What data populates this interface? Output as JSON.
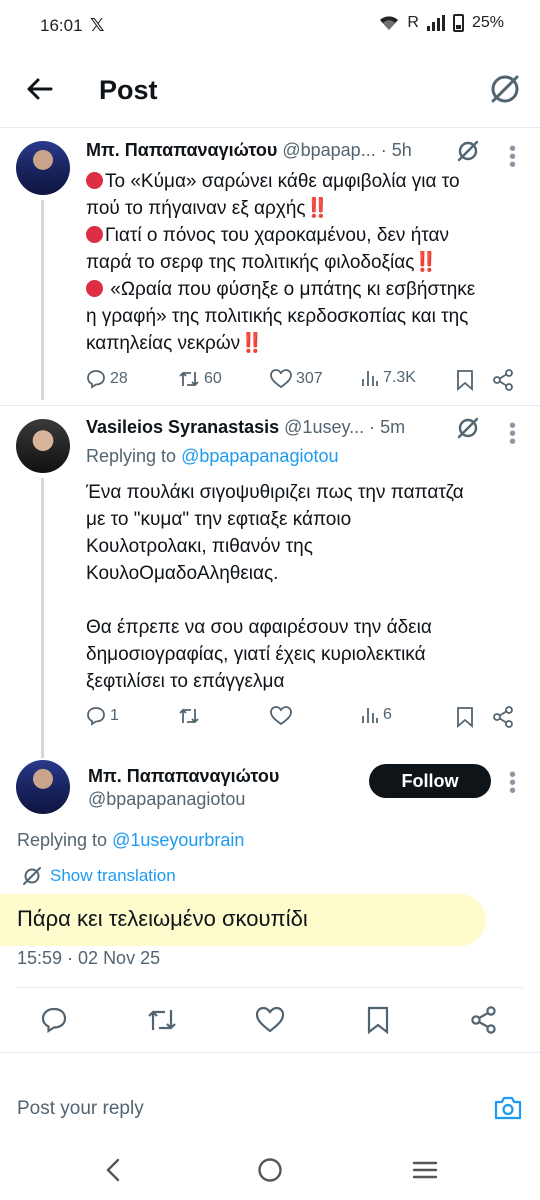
{
  "status_bar": {
    "time": "16:01",
    "x_label": "𝕏",
    "signal_label": "R",
    "battery": "25%"
  },
  "header": {
    "title": "Post",
    "back_icon": "arrow-left-icon",
    "grok_icon": "grok-icon"
  },
  "tweets": [
    {
      "name": "Μπ. Παπαπαναγιώτου",
      "handle": "@bpapap...",
      "time": "· 5h",
      "lines": [
        "Το «Κύμα» σαρώνει κάθε αμφιβολία για το",
        "πού το πήγαιναν εξ αρχής",
        "Γιατί ο πόνος του χαροκαμένου, δεν ήταν",
        "παρά το σερφ της πολιτικής φιλοδοξίας",
        " «Ωραία που φύσηξε ο μπάτης κι εσβήστηκε",
        "η γραφή» της πολιτικής κερδοσκοπίας και της",
        "καπηλείας νεκρών"
      ],
      "emphasis_mark": "‼️",
      "replies": "28",
      "reposts": "60",
      "likes": "307",
      "views": "7.3K"
    },
    {
      "name": "Vasileios Syranastasis",
      "handle": "@1usey...",
      "time": "· 5m",
      "replying_to_label": "Replying to",
      "replying_to_handle": "@bpapapanagiotou",
      "text": "Ένα πουλάκι σιγοψυθιριζει πως την παπατζα\nμε το \"κυμα\" την εφτιαξε κάποιο\nΚουλοτρολακι, πιθανόν της\nΚουλοΟμαδοΑληθειας.\n\nΘα έπρεπε να σου αφαιρέσουν την άδεια\nδημοσιογραφίας, γιατί έχεις κυριολεκτικά\nξεφτιλίσει το επάγγελμα",
      "replies": "1",
      "reposts": "",
      "likes": "",
      "views": "6"
    }
  ],
  "main_post": {
    "name": "Μπ. Παπαπαναγιώτου",
    "handle": "@bpapapanagiotou",
    "follow_label": "Follow",
    "replying_to_label": "Replying to",
    "replying_to_handle": "@1useyourbrain",
    "show_translation": "Show translation",
    "text": "Πάρα κει τελειωμένο σκουπίδι",
    "timestamp": "15:59 · 02 Nov 25",
    "highlight_color": "#fefbcd"
  },
  "reply_box": {
    "placeholder": "Post your reply",
    "camera_icon": "camera-icon"
  },
  "colors": {
    "link": "#1d9bf0",
    "secondary": "#536471",
    "primary": "#0f1419",
    "emoji_red": "#dd2e44"
  }
}
